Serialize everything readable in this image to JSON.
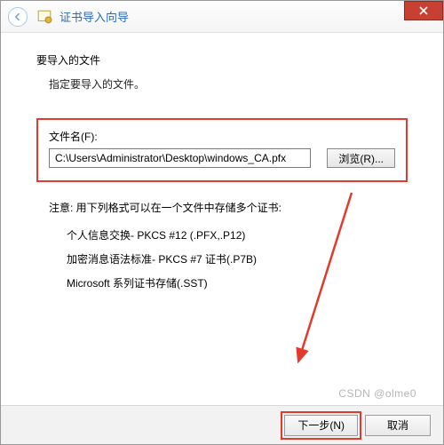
{
  "titlebar": {
    "title": "证书导入向导"
  },
  "section": {
    "heading": "要导入的文件",
    "sub": "指定要导入的文件。"
  },
  "file": {
    "label": "文件名(F):",
    "value": "C:\\Users\\Administrator\\Desktop\\windows_CA.pfx",
    "browse": "浏览(R)..."
  },
  "note": {
    "head": "注意: 用下列格式可以在一个文件中存储多个证书:",
    "items": [
      "个人信息交换- PKCS #12 (.PFX,.P12)",
      "加密消息语法标准- PKCS #7 证书(.P7B)",
      "Microsoft 系列证书存储(.SST)"
    ]
  },
  "footer": {
    "next": "下一步(N)",
    "cancel": "取消"
  },
  "watermark": "CSDN @olme0"
}
